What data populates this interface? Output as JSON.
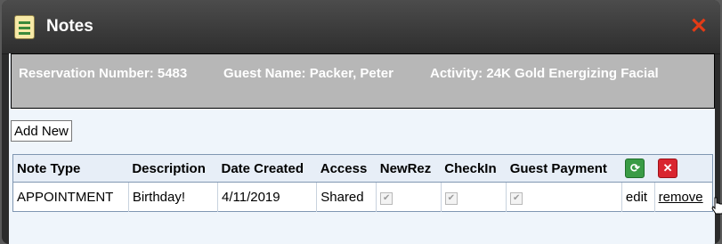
{
  "window": {
    "title": "Notes",
    "icon": "notes-icon",
    "close_icon": "close-icon"
  },
  "info": {
    "reservation": "Reservation Number: 5483",
    "guest": "Guest Name: Packer, Peter",
    "activity": "Activity: 24K Gold Energizing Facial"
  },
  "toolbar": {
    "add_label": "Add New"
  },
  "table": {
    "headers": [
      "Note Type",
      "Description",
      "Date Created",
      "Access",
      "NewRez",
      "CheckIn",
      "Guest Payment"
    ],
    "header_icons": [
      "refresh-icon",
      "delete-icon"
    ],
    "rows": [
      {
        "note_type": "APPOINTMENT",
        "description": "Birthday!",
        "date_created": "4/11/2019",
        "access": "Shared",
        "newrez": true,
        "checkin": true,
        "guest_payment": true,
        "edit": "edit",
        "remove": "remove"
      }
    ]
  },
  "colors": {
    "title_bar": "#3a3a3a",
    "close": "#e33b16",
    "info_bg": "#b7b7b7",
    "content_bg": "#eff5fb",
    "refresh": "#3a9b45",
    "delete": "#d9252f"
  }
}
